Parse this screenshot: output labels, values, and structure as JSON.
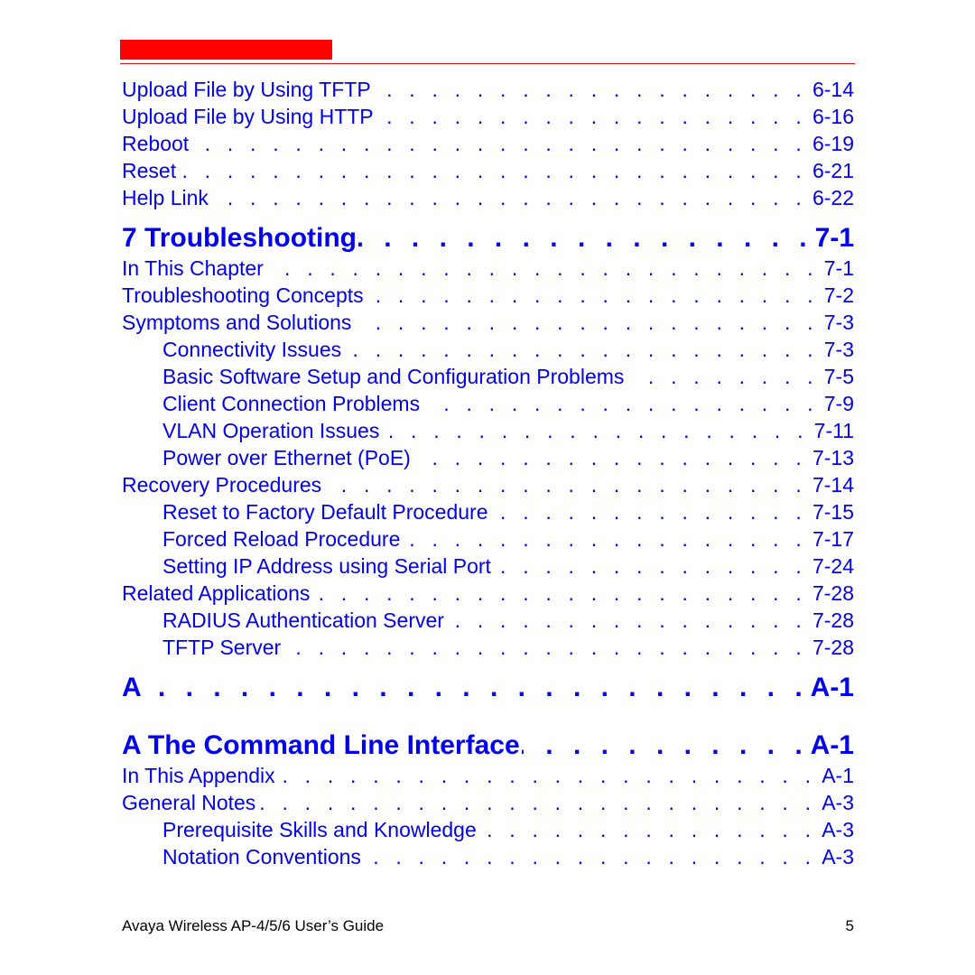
{
  "header": {
    "accent_color": "#ff0000"
  },
  "toc": {
    "group1": [
      {
        "label": "Upload File by Using TFTP",
        "page": "6-14"
      },
      {
        "label": "Upload File by Using HTTP",
        "page": "6-16"
      },
      {
        "label": "Reboot",
        "page": "6-19"
      },
      {
        "label": "Reset",
        "page": "6-21"
      },
      {
        "label": "Help Link",
        "page": "6-22"
      }
    ],
    "chapter7": {
      "label": "7 Troubleshooting",
      "page": "7-1"
    },
    "group2": [
      {
        "label": "In This Chapter",
        "page": "7-1",
        "level": 1
      },
      {
        "label": "Troubleshooting Concepts",
        "page": "7-2",
        "level": 1
      },
      {
        "label": "Symptoms and Solutions",
        "page": "7-3",
        "level": 1
      },
      {
        "label": "Connectivity Issues",
        "page": "7-3",
        "level": 2
      },
      {
        "label": "Basic Software Setup and Configuration Problems",
        "page": "7-5",
        "level": 2
      },
      {
        "label": "Client Connection Problems",
        "page": "7-9",
        "level": 2
      },
      {
        "label": "VLAN Operation Issues",
        "page": "7-11",
        "level": 2
      },
      {
        "label": "Power over Ethernet (PoE)",
        "page": "7-13",
        "level": 2
      },
      {
        "label": "Recovery Procedures",
        "page": "7-14",
        "level": 1
      },
      {
        "label": "Reset to Factory Default Procedure",
        "page": "7-15",
        "level": 2
      },
      {
        "label": "Forced Reload Procedure",
        "page": "7-17",
        "level": 2
      },
      {
        "label": "Setting IP Address using Serial Port",
        "page": "7-24",
        "level": 2
      },
      {
        "label": "Related Applications",
        "page": "7-28",
        "level": 1
      },
      {
        "label": "RADIUS Authentication Server",
        "page": "7-28",
        "level": 2
      },
      {
        "label": "TFTP Server",
        "page": "7-28",
        "level": 2
      }
    ],
    "appendixA": {
      "label": "A",
      "page": "A-1"
    },
    "appendixCLI": {
      "label": "A The Command Line Interface",
      "page": "A-1"
    },
    "group3": [
      {
        "label": "In This Appendix",
        "page": "A-1",
        "level": 1
      },
      {
        "label": "General Notes",
        "page": "A-3",
        "level": 1
      },
      {
        "label": "Prerequisite Skills and Knowledge",
        "page": "A-3",
        "level": 2
      },
      {
        "label": "Notation Conventions",
        "page": "A-3",
        "level": 2
      }
    ],
    "link_color": "#0000ee",
    "leader": ". . . . . . . . . . . . . . . . . . . . . . . . . . . . . . . . . . . . . . . . . . . . . . . . . . . . . . . . . . . . ."
  },
  "footer": {
    "title": "Avaya Wireless AP-4/5/6 User’s Guide",
    "page_number": "5"
  }
}
